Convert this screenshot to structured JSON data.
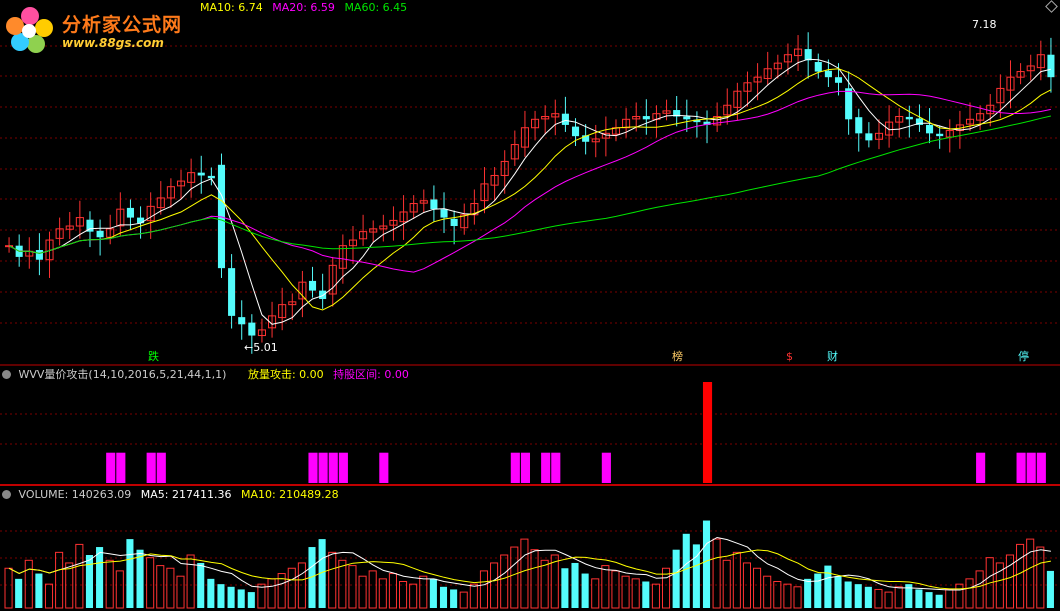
{
  "logo": {
    "title": "分析家公式网",
    "url": "www.88gs.com"
  },
  "price_header": {
    "ma10": "MA10: 6.74",
    "ma20": "MA20: 6.59",
    "ma60": "MA60: 6.45"
  },
  "attack_header": {
    "title": "WVV量价攻击(14,10,2016,5,21,44,1,1)",
    "attack": "放量攻击: 0.00",
    "hold": "持股区间: 0.00"
  },
  "volume_header": {
    "volume": "VOLUME: 140263.09",
    "ma5": "MA5: 217411.36",
    "ma10": "MA10: 210489.28"
  },
  "markers": {
    "low_label": "←5.01",
    "high_label": "7.18",
    "m1": "跌",
    "m2": "榜",
    "m3": "$",
    "m4": "财",
    "m5": "停"
  },
  "colors": {
    "up": "#ff3232",
    "down": "#54fcfc",
    "ma5": "#ffffff",
    "ma10": "#ffff00",
    "ma20": "#ff00ff",
    "ma60": "#00e400",
    "grid": "#7a0000",
    "attack_bar": "#ff00ff",
    "attack_peak": "#ff0000"
  },
  "chart_data": [
    {
      "type": "candlestick",
      "panel": "price",
      "ylim": [
        4.9,
        7.35
      ],
      "low_marked": 5.01,
      "high_marked": 7.18,
      "ohlc_close_sequence": [
        5.7,
        5.62,
        5.66,
        5.6,
        5.74,
        5.82,
        5.84,
        5.9,
        5.8,
        5.76,
        5.82,
        5.96,
        5.9,
        5.86,
        5.98,
        6.04,
        6.12,
        6.16,
        6.22,
        6.2,
        6.18,
        5.54,
        5.2,
        5.14,
        5.06,
        5.1,
        5.2,
        5.28,
        5.3,
        5.44,
        5.38,
        5.32,
        5.56,
        5.7,
        5.74,
        5.8,
        5.82,
        5.84,
        5.88,
        5.94,
        6.0,
        6.02,
        5.96,
        5.9,
        5.84,
        5.92,
        6.0,
        6.14,
        6.2,
        6.3,
        6.42,
        6.54,
        6.6,
        6.62,
        6.64,
        6.56,
        6.48,
        6.44,
        6.46,
        6.5,
        6.54,
        6.6,
        6.62,
        6.6,
        6.64,
        6.66,
        6.62,
        6.6,
        6.58,
        6.56,
        6.62,
        6.7,
        6.8,
        6.86,
        6.9,
        6.96,
        7.0,
        7.06,
        7.1,
        7.02,
        6.94,
        6.9,
        6.86,
        6.6,
        6.5,
        6.45,
        6.5,
        6.58,
        6.62,
        6.6,
        6.56,
        6.5,
        6.48,
        6.52,
        6.56,
        6.6,
        6.64,
        6.7,
        6.82,
        6.9,
        6.94,
        6.98,
        7.06,
        6.9
      ],
      "ma_legend": [
        "MA10",
        "MA20",
        "MA60"
      ]
    },
    {
      "type": "bar",
      "panel": "attack",
      "title": "WVV量价攻击(14,10,2016,5,21,44,1,1)",
      "values_norm": [
        0,
        0,
        0,
        0,
        0,
        0,
        0,
        0,
        0,
        0,
        0.3,
        0.3,
        0,
        0,
        0.3,
        0.3,
        0,
        0,
        0,
        0,
        0,
        0,
        0,
        0,
        0,
        0,
        0,
        0,
        0,
        0,
        0.3,
        0.3,
        0.3,
        0.3,
        0,
        0,
        0,
        0.3,
        0,
        0,
        0,
        0,
        0,
        0,
        0,
        0,
        0,
        0,
        0,
        0,
        0.3,
        0.3,
        0,
        0.3,
        0.3,
        0,
        0,
        0,
        0,
        0.3,
        0,
        0,
        0,
        0,
        0,
        0,
        0,
        0,
        0,
        1,
        0,
        0,
        0,
        0,
        0,
        0,
        0,
        0,
        0,
        0,
        0,
        0,
        0,
        0,
        0,
        0,
        0,
        0,
        0,
        0,
        0,
        0,
        0,
        0,
        0,
        0,
        0.3,
        0,
        0,
        0,
        0.3,
        0.3,
        0.3,
        0
      ],
      "peak_index": 69
    },
    {
      "type": "bar",
      "panel": "volume",
      "ylim": [
        0,
        400000
      ],
      "values": [
        150000,
        110000,
        180000,
        130000,
        90000,
        210000,
        170000,
        240000,
        200000,
        230000,
        180000,
        140000,
        260000,
        220000,
        190000,
        160000,
        150000,
        120000,
        200000,
        170000,
        110000,
        90000,
        80000,
        70000,
        60000,
        90000,
        110000,
        130000,
        150000,
        170000,
        230000,
        260000,
        210000,
        180000,
        160000,
        120000,
        140000,
        110000,
        130000,
        100000,
        90000,
        120000,
        110000,
        80000,
        70000,
        60000,
        90000,
        140000,
        170000,
        200000,
        230000,
        260000,
        220000,
        180000,
        200000,
        150000,
        170000,
        130000,
        110000,
        160000,
        140000,
        120000,
        110000,
        100000,
        90000,
        150000,
        220000,
        280000,
        240000,
        330000,
        260000,
        180000,
        210000,
        170000,
        150000,
        120000,
        100000,
        90000,
        80000,
        110000,
        130000,
        160000,
        120000,
        100000,
        90000,
        80000,
        70000,
        60000,
        80000,
        90000,
        70000,
        60000,
        50000,
        70000,
        90000,
        110000,
        140000,
        190000,
        170000,
        200000,
        240000,
        260000,
        230000,
        140000
      ],
      "volume_value": 140263.09,
      "ma5": 217411.36,
      "ma10": 210489.28
    }
  ]
}
